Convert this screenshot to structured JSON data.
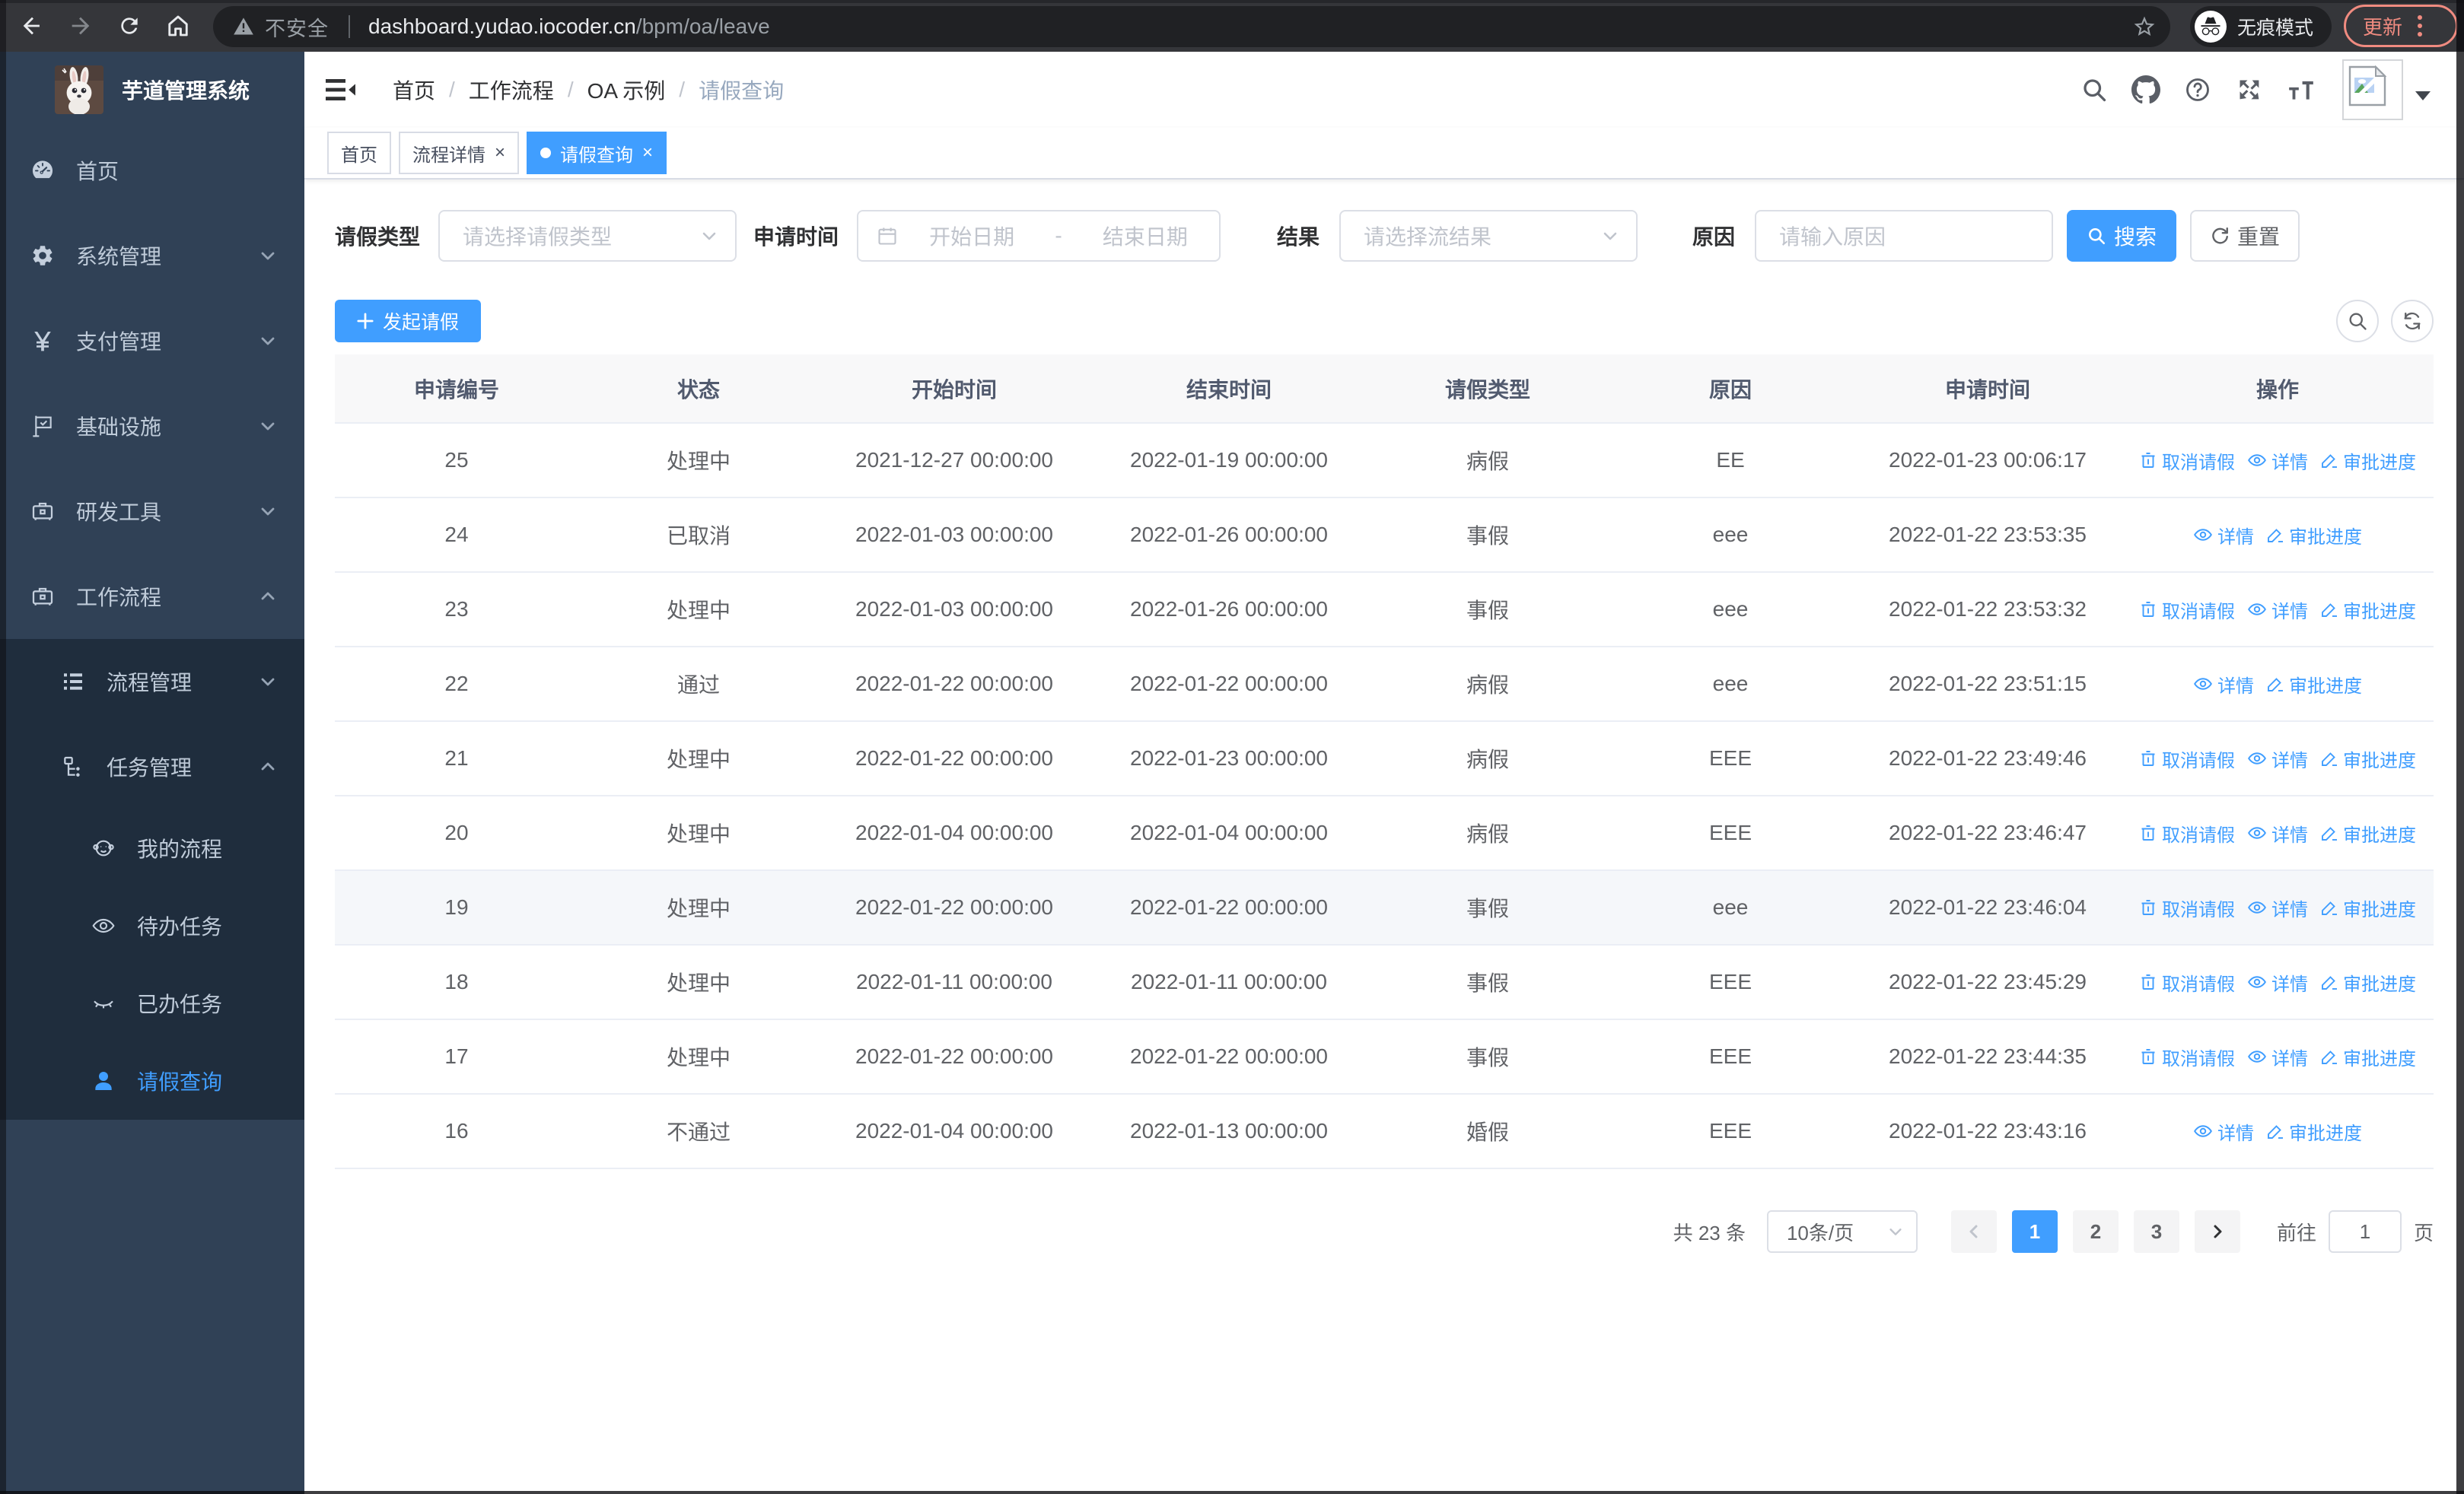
{
  "colors": {
    "accent": "#409eff",
    "sidebar_bg": "#304156",
    "submenu_bg": "#1f2d3d",
    "update_badge": "#f08b80"
  },
  "browser": {
    "security_label": "不安全",
    "url_host": "dashboard.yudao.iocoder.cn",
    "url_path": "/bpm/oa/leave",
    "incognito_label": "无痕模式",
    "update_label": "更新"
  },
  "sidebar": {
    "title": "芋道管理系统",
    "items": [
      {
        "label": "首页"
      },
      {
        "label": "系统管理"
      },
      {
        "label": "支付管理"
      },
      {
        "label": "基础设施"
      },
      {
        "label": "研发工具"
      },
      {
        "label": "工作流程"
      }
    ],
    "submenu": [
      {
        "label": "流程管理"
      },
      {
        "label": "任务管理"
      }
    ],
    "children": [
      {
        "label": "我的流程"
      },
      {
        "label": "待办任务"
      },
      {
        "label": "已办任务"
      },
      {
        "label": "请假查询"
      }
    ]
  },
  "navbar": {
    "breadcrumb": [
      "首页",
      "工作流程",
      "OA 示例",
      "请假查询"
    ]
  },
  "tags": [
    {
      "label": "首页"
    },
    {
      "label": "流程详情"
    },
    {
      "label": "请假查询"
    }
  ],
  "filters": {
    "leave_type": {
      "label": "请假类型",
      "placeholder": "请选择请假类型"
    },
    "apply_time": {
      "label": "申请时间",
      "start_placeholder": "开始日期",
      "separator": "-",
      "end_placeholder": "结束日期"
    },
    "result": {
      "label": "结果",
      "placeholder": "请选择流结果"
    },
    "reason": {
      "label": "原因",
      "placeholder": "请输入原因"
    },
    "search_label": "搜索",
    "reset_label": "重置"
  },
  "actions": {
    "create_label": "发起请假"
  },
  "table": {
    "headers": [
      "申请编号",
      "状态",
      "开始时间",
      "结束时间",
      "请假类型",
      "原因",
      "申请时间",
      "操作"
    ],
    "ops_labels": {
      "cancel": "取消请假",
      "detail": "详情",
      "progress": "审批进度"
    },
    "rows": [
      {
        "id": "25",
        "status": "处理中",
        "start": "2021-12-27 00:00:00",
        "end": "2022-01-19 00:00:00",
        "type": "病假",
        "reason": "EE",
        "apply": "2022-01-23 00:06:17",
        "ops": [
          "cancel",
          "detail",
          "progress"
        ],
        "highlight": false
      },
      {
        "id": "24",
        "status": "已取消",
        "start": "2022-01-03 00:00:00",
        "end": "2022-01-26 00:00:00",
        "type": "事假",
        "reason": "eee",
        "apply": "2022-01-22 23:53:35",
        "ops": [
          "detail",
          "progress"
        ],
        "highlight": false
      },
      {
        "id": "23",
        "status": "处理中",
        "start": "2022-01-03 00:00:00",
        "end": "2022-01-26 00:00:00",
        "type": "事假",
        "reason": "eee",
        "apply": "2022-01-22 23:53:32",
        "ops": [
          "cancel",
          "detail",
          "progress"
        ],
        "highlight": false
      },
      {
        "id": "22",
        "status": "通过",
        "start": "2022-01-22 00:00:00",
        "end": "2022-01-22 00:00:00",
        "type": "病假",
        "reason": "eee",
        "apply": "2022-01-22 23:51:15",
        "ops": [
          "detail",
          "progress"
        ],
        "highlight": false
      },
      {
        "id": "21",
        "status": "处理中",
        "start": "2022-01-22 00:00:00",
        "end": "2022-01-23 00:00:00",
        "type": "病假",
        "reason": "EEE",
        "apply": "2022-01-22 23:49:46",
        "ops": [
          "cancel",
          "detail",
          "progress"
        ],
        "highlight": false
      },
      {
        "id": "20",
        "status": "处理中",
        "start": "2022-01-04 00:00:00",
        "end": "2022-01-04 00:00:00",
        "type": "病假",
        "reason": "EEE",
        "apply": "2022-01-22 23:46:47",
        "ops": [
          "cancel",
          "detail",
          "progress"
        ],
        "highlight": false
      },
      {
        "id": "19",
        "status": "处理中",
        "start": "2022-01-22 00:00:00",
        "end": "2022-01-22 00:00:00",
        "type": "事假",
        "reason": "eee",
        "apply": "2022-01-22 23:46:04",
        "ops": [
          "cancel",
          "detail",
          "progress"
        ],
        "highlight": true
      },
      {
        "id": "18",
        "status": "处理中",
        "start": "2022-01-11 00:00:00",
        "end": "2022-01-11 00:00:00",
        "type": "事假",
        "reason": "EEE",
        "apply": "2022-01-22 23:45:29",
        "ops": [
          "cancel",
          "detail",
          "progress"
        ],
        "highlight": false
      },
      {
        "id": "17",
        "status": "处理中",
        "start": "2022-01-22 00:00:00",
        "end": "2022-01-22 00:00:00",
        "type": "事假",
        "reason": "EEE",
        "apply": "2022-01-22 23:44:35",
        "ops": [
          "cancel",
          "detail",
          "progress"
        ],
        "highlight": false
      },
      {
        "id": "16",
        "status": "不通过",
        "start": "2022-01-04 00:00:00",
        "end": "2022-01-13 00:00:00",
        "type": "婚假",
        "reason": "EEE",
        "apply": "2022-01-22 23:43:16",
        "ops": [
          "detail",
          "progress"
        ],
        "highlight": false
      }
    ]
  },
  "pagination": {
    "total_label": "共 23 条",
    "page_size_label": "10条/页",
    "pages": [
      "1",
      "2",
      "3"
    ],
    "current_page": "1",
    "goto_label": "前往",
    "goto_value": "1",
    "page_unit": "页"
  }
}
